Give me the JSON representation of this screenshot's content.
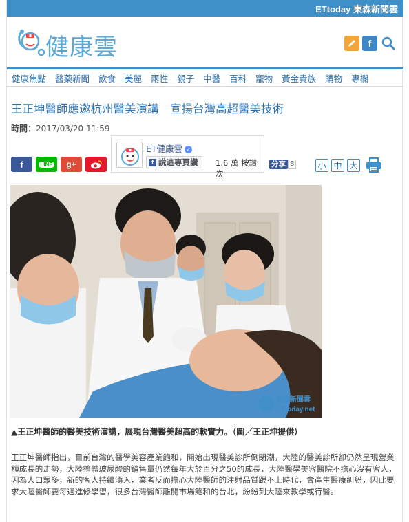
{
  "topbar": {
    "brand": "ETtoday 東森新聞雲"
  },
  "header": {
    "logo_text": "健康雲"
  },
  "nav": {
    "items": [
      "健康焦點",
      "醫藥新聞",
      "飲食",
      "美麗",
      "兩性",
      "親子",
      "中醫",
      "百科",
      "寵物",
      "黃金貴族",
      "購物",
      "專欄"
    ]
  },
  "article": {
    "title": "王正坤醫師應邀杭州醫美演講　宣揚台灣高超醫美技術",
    "time_label": "時間：",
    "time": "2017/03/20 11:59"
  },
  "share": {
    "line_label": "LINE",
    "gplus_label": "g+"
  },
  "fanbox": {
    "name": "ET健康雲",
    "like_label": "說這專頁讚",
    "count": "1.6 萬 按讚次"
  },
  "fb_share": {
    "label": "分享",
    "count": "8"
  },
  "font_sizes": {
    "small": "小",
    "medium": "中",
    "large": "大"
  },
  "photo": {
    "watermark_cn": "東森新聞雲",
    "watermark_en": "ETtoday.net"
  },
  "caption": "▲王正坤醫師的醫美技術演講，展現台灣醫美超高的軟實力。（圖／王正坤提供）",
  "body": "王正坤醫師指出，目前台灣的醫學美容產業飽和，開始出現醫美診所倒閉潮，大陸的醫美診所卻仍然呈現營業額成長的走勢，大陸整體玻尿酸的銷售量仍然每年大於百分之50的成長，大陸醫學美容醫院不擔心沒有客人，因為人口眾多，新的客人持續湧入，業者反而擔心大陸醫師的注射品質跟不上時代，會產生醫療糾紛，因此要求大陸醫師要每週進修學習，很多台灣醫師離開市場飽和的台北，紛紛到大陸來教學或行醫。",
  "colors": {
    "brand_blue": "#3f8fc9",
    "link_blue": "#2e74b5",
    "facebook": "#3b5998"
  },
  "icons": [
    "pen-icon",
    "facebook-icon",
    "search-icon",
    "print-icon"
  ]
}
